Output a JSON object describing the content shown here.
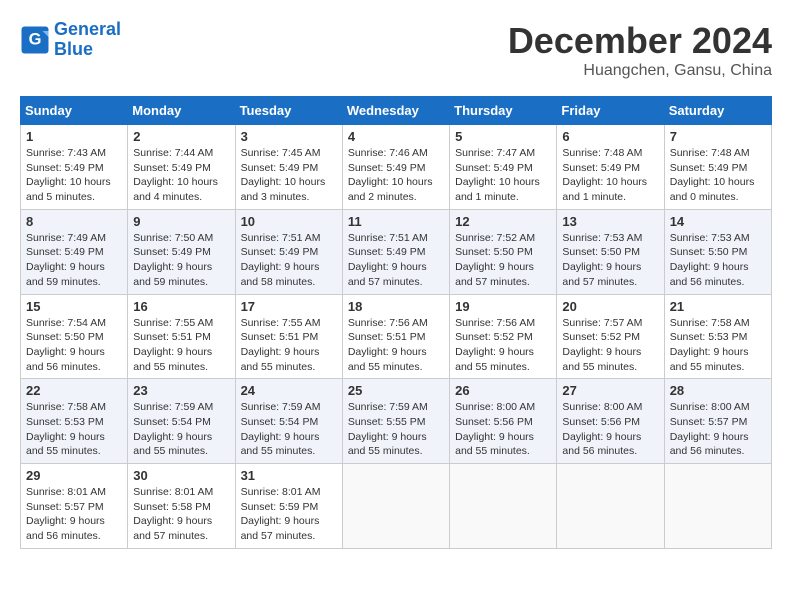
{
  "logo": {
    "line1": "General",
    "line2": "Blue"
  },
  "title": "December 2024",
  "location": "Huangchen, Gansu, China",
  "days_of_week": [
    "Sunday",
    "Monday",
    "Tuesday",
    "Wednesday",
    "Thursday",
    "Friday",
    "Saturday"
  ],
  "weeks": [
    [
      {
        "day": "1",
        "sunrise": "7:43 AM",
        "sunset": "5:49 PM",
        "daylight": "10 hours and 5 minutes."
      },
      {
        "day": "2",
        "sunrise": "7:44 AM",
        "sunset": "5:49 PM",
        "daylight": "10 hours and 4 minutes."
      },
      {
        "day": "3",
        "sunrise": "7:45 AM",
        "sunset": "5:49 PM",
        "daylight": "10 hours and 3 minutes."
      },
      {
        "day": "4",
        "sunrise": "7:46 AM",
        "sunset": "5:49 PM",
        "daylight": "10 hours and 2 minutes."
      },
      {
        "day": "5",
        "sunrise": "7:47 AM",
        "sunset": "5:49 PM",
        "daylight": "10 hours and 1 minute."
      },
      {
        "day": "6",
        "sunrise": "7:48 AM",
        "sunset": "5:49 PM",
        "daylight": "10 hours and 1 minute."
      },
      {
        "day": "7",
        "sunrise": "7:48 AM",
        "sunset": "5:49 PM",
        "daylight": "10 hours and 0 minutes."
      }
    ],
    [
      {
        "day": "8",
        "sunrise": "7:49 AM",
        "sunset": "5:49 PM",
        "daylight": "9 hours and 59 minutes."
      },
      {
        "day": "9",
        "sunrise": "7:50 AM",
        "sunset": "5:49 PM",
        "daylight": "9 hours and 59 minutes."
      },
      {
        "day": "10",
        "sunrise": "7:51 AM",
        "sunset": "5:49 PM",
        "daylight": "9 hours and 58 minutes."
      },
      {
        "day": "11",
        "sunrise": "7:51 AM",
        "sunset": "5:49 PM",
        "daylight": "9 hours and 57 minutes."
      },
      {
        "day": "12",
        "sunrise": "7:52 AM",
        "sunset": "5:50 PM",
        "daylight": "9 hours and 57 minutes."
      },
      {
        "day": "13",
        "sunrise": "7:53 AM",
        "sunset": "5:50 PM",
        "daylight": "9 hours and 57 minutes."
      },
      {
        "day": "14",
        "sunrise": "7:53 AM",
        "sunset": "5:50 PM",
        "daylight": "9 hours and 56 minutes."
      }
    ],
    [
      {
        "day": "15",
        "sunrise": "7:54 AM",
        "sunset": "5:50 PM",
        "daylight": "9 hours and 56 minutes."
      },
      {
        "day": "16",
        "sunrise": "7:55 AM",
        "sunset": "5:51 PM",
        "daylight": "9 hours and 55 minutes."
      },
      {
        "day": "17",
        "sunrise": "7:55 AM",
        "sunset": "5:51 PM",
        "daylight": "9 hours and 55 minutes."
      },
      {
        "day": "18",
        "sunrise": "7:56 AM",
        "sunset": "5:51 PM",
        "daylight": "9 hours and 55 minutes."
      },
      {
        "day": "19",
        "sunrise": "7:56 AM",
        "sunset": "5:52 PM",
        "daylight": "9 hours and 55 minutes."
      },
      {
        "day": "20",
        "sunrise": "7:57 AM",
        "sunset": "5:52 PM",
        "daylight": "9 hours and 55 minutes."
      },
      {
        "day": "21",
        "sunrise": "7:58 AM",
        "sunset": "5:53 PM",
        "daylight": "9 hours and 55 minutes."
      }
    ],
    [
      {
        "day": "22",
        "sunrise": "7:58 AM",
        "sunset": "5:53 PM",
        "daylight": "9 hours and 55 minutes."
      },
      {
        "day": "23",
        "sunrise": "7:59 AM",
        "sunset": "5:54 PM",
        "daylight": "9 hours and 55 minutes."
      },
      {
        "day": "24",
        "sunrise": "7:59 AM",
        "sunset": "5:54 PM",
        "daylight": "9 hours and 55 minutes."
      },
      {
        "day": "25",
        "sunrise": "7:59 AM",
        "sunset": "5:55 PM",
        "daylight": "9 hours and 55 minutes."
      },
      {
        "day": "26",
        "sunrise": "8:00 AM",
        "sunset": "5:56 PM",
        "daylight": "9 hours and 55 minutes."
      },
      {
        "day": "27",
        "sunrise": "8:00 AM",
        "sunset": "5:56 PM",
        "daylight": "9 hours and 56 minutes."
      },
      {
        "day": "28",
        "sunrise": "8:00 AM",
        "sunset": "5:57 PM",
        "daylight": "9 hours and 56 minutes."
      }
    ],
    [
      {
        "day": "29",
        "sunrise": "8:01 AM",
        "sunset": "5:57 PM",
        "daylight": "9 hours and 56 minutes."
      },
      {
        "day": "30",
        "sunrise": "8:01 AM",
        "sunset": "5:58 PM",
        "daylight": "9 hours and 57 minutes."
      },
      {
        "day": "31",
        "sunrise": "8:01 AM",
        "sunset": "5:59 PM",
        "daylight": "9 hours and 57 minutes."
      },
      null,
      null,
      null,
      null
    ]
  ],
  "labels": {
    "sunrise": "Sunrise:",
    "sunset": "Sunset:",
    "daylight": "Daylight:"
  }
}
